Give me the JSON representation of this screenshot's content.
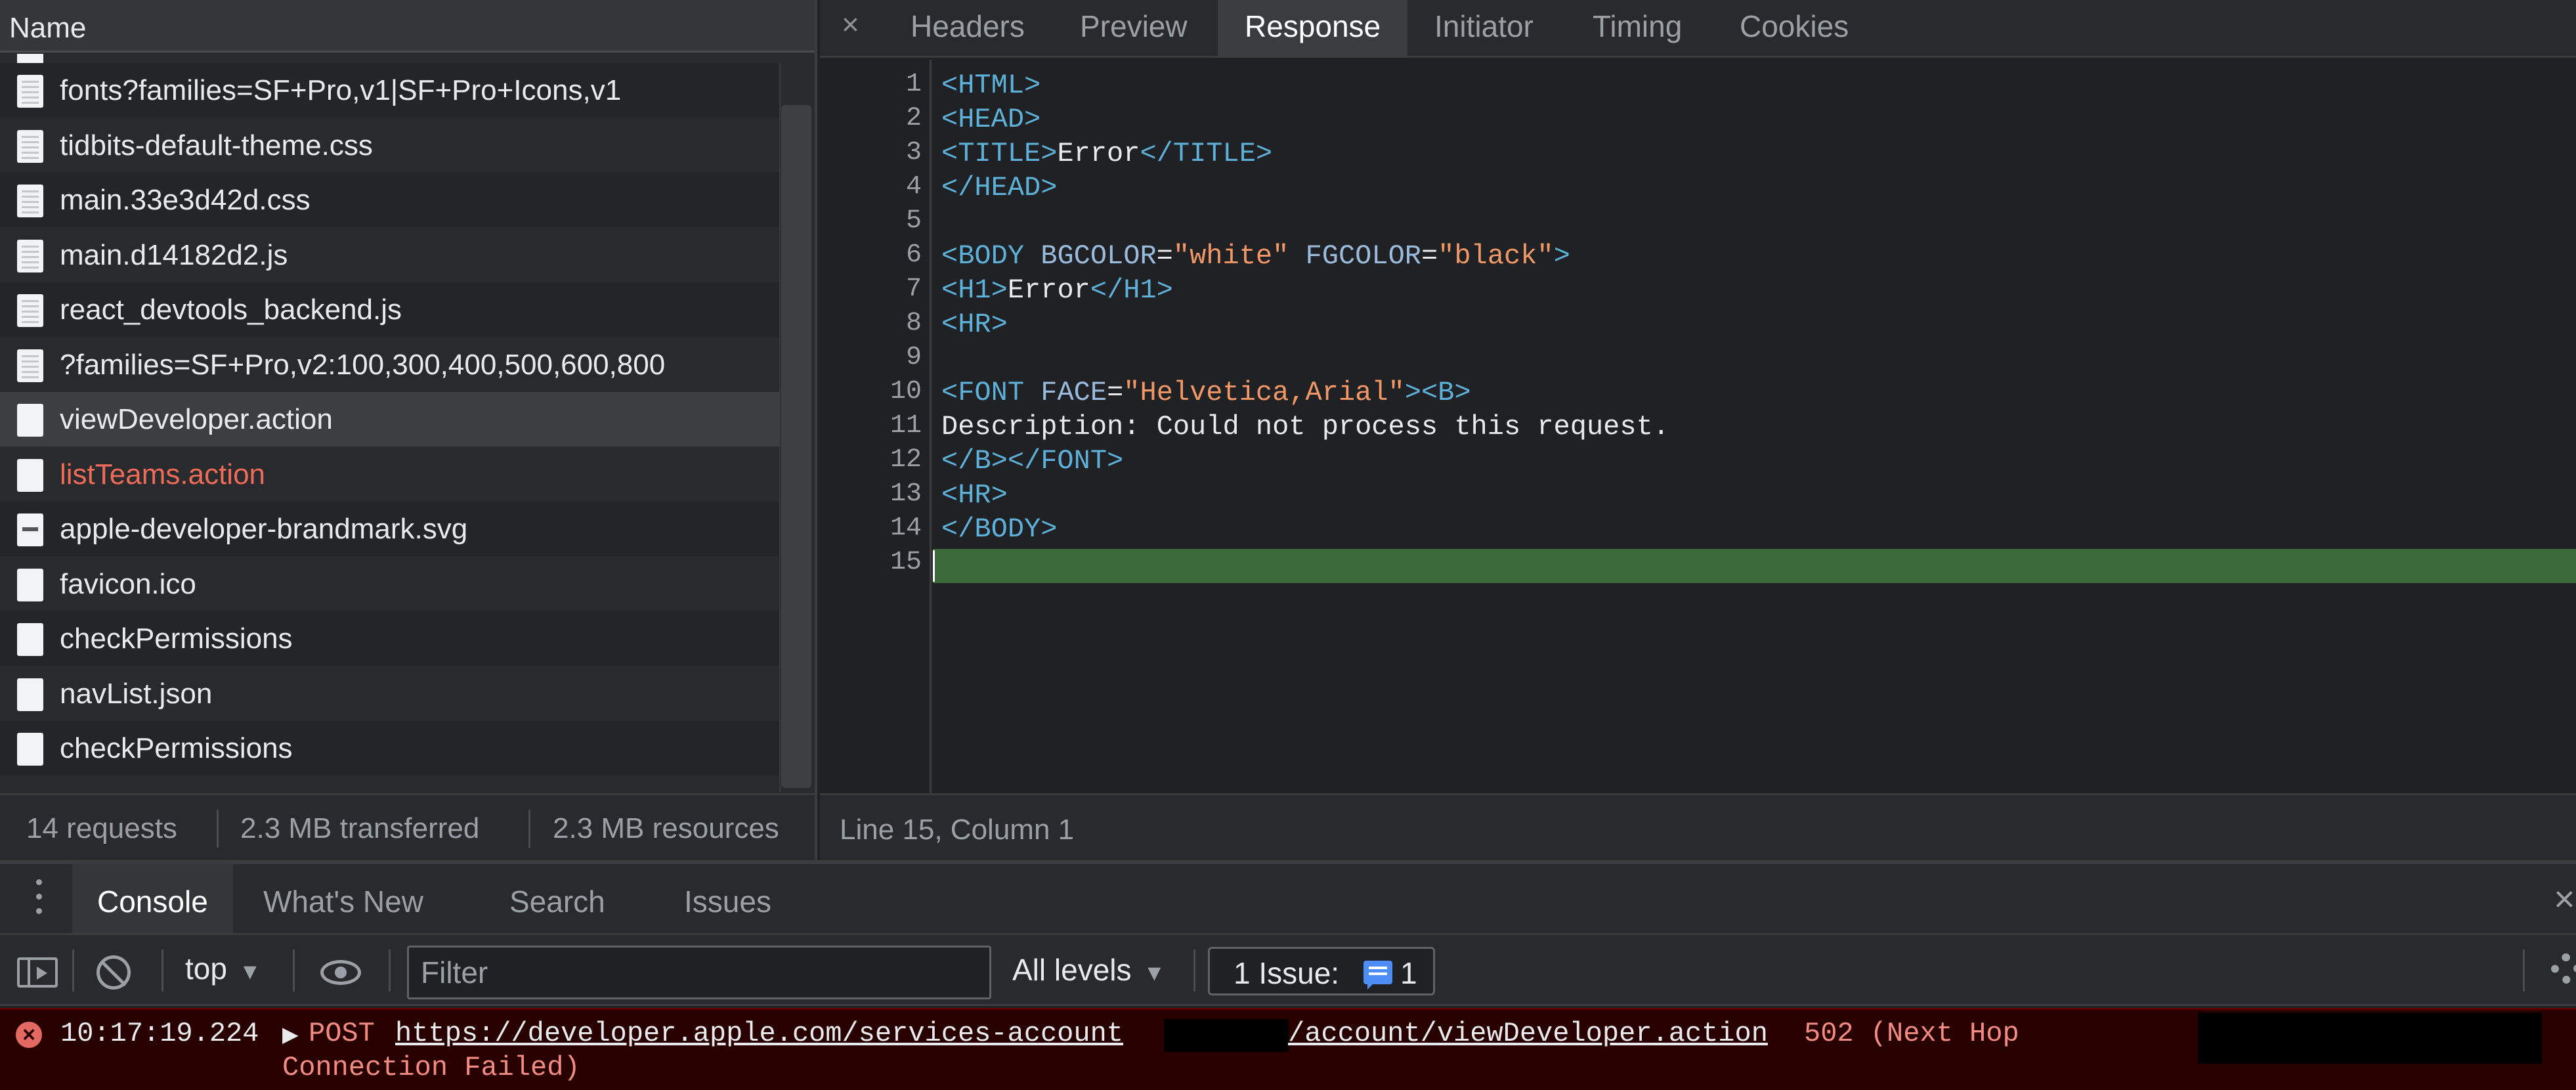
{
  "network": {
    "name_header": "Name",
    "requests": [
      {
        "name": "fonts?families=SF+Pro,v1|SF+Pro+Icons,v1",
        "icon": "document-icon",
        "status": "normal"
      },
      {
        "name": "tidbits-default-theme.css",
        "icon": "document-icon",
        "status": "normal"
      },
      {
        "name": "main.33e3d42d.css",
        "icon": "document-icon",
        "status": "normal"
      },
      {
        "name": "main.d14182d2.js",
        "icon": "document-icon",
        "status": "normal"
      },
      {
        "name": "react_devtools_backend.js",
        "icon": "document-icon",
        "status": "normal"
      },
      {
        "name": "?families=SF+Pro,v2:100,300,400,500,600,800",
        "icon": "document-icon",
        "status": "normal"
      },
      {
        "name": "viewDeveloper.action",
        "icon": "file-icon",
        "status": "selected"
      },
      {
        "name": "listTeams.action",
        "icon": "file-icon",
        "status": "error"
      },
      {
        "name": "apple-developer-brandmark.svg",
        "icon": "image-icon",
        "status": "normal"
      },
      {
        "name": "favicon.ico",
        "icon": "file-icon",
        "status": "normal"
      },
      {
        "name": "checkPermissions",
        "icon": "file-icon",
        "status": "normal"
      },
      {
        "name": "navList.json",
        "icon": "file-icon",
        "status": "normal"
      },
      {
        "name": "checkPermissions",
        "icon": "file-icon",
        "status": "normal"
      }
    ],
    "summary": {
      "requests": "14 requests",
      "transferred": "2.3 MB transferred",
      "resources": "2.3 MB resources"
    }
  },
  "details": {
    "close": "×",
    "tabs": [
      "Headers",
      "Preview",
      "Response",
      "Initiator",
      "Timing",
      "Cookies"
    ],
    "active_tab": "Response",
    "code_lines": [
      [
        {
          "t": "<HTML>",
          "c": "tag"
        }
      ],
      [
        {
          "t": "<HEAD>",
          "c": "tag"
        }
      ],
      [
        {
          "t": "<TITLE>",
          "c": "tag"
        },
        {
          "t": "Error",
          "c": "txt"
        },
        {
          "t": "</TITLE>",
          "c": "tag"
        }
      ],
      [
        {
          "t": "</HEAD>",
          "c": "tag"
        }
      ],
      [],
      [
        {
          "t": "<BODY ",
          "c": "tag"
        },
        {
          "t": "BGCOLOR",
          "c": "attr"
        },
        {
          "t": "=",
          "c": "txt"
        },
        {
          "t": "\"white\"",
          "c": "str"
        },
        {
          "t": " ",
          "c": "txt"
        },
        {
          "t": "FGCOLOR",
          "c": "attr"
        },
        {
          "t": "=",
          "c": "txt"
        },
        {
          "t": "\"black\"",
          "c": "str"
        },
        {
          "t": ">",
          "c": "tag"
        }
      ],
      [
        {
          "t": "<H1>",
          "c": "tag"
        },
        {
          "t": "Error",
          "c": "txt"
        },
        {
          "t": "</H1>",
          "c": "tag"
        }
      ],
      [
        {
          "t": "<HR>",
          "c": "tag"
        }
      ],
      [],
      [
        {
          "t": "<FONT ",
          "c": "tag"
        },
        {
          "t": "FACE",
          "c": "attr"
        },
        {
          "t": "=",
          "c": "txt"
        },
        {
          "t": "\"Helvetica,Arial\"",
          "c": "str"
        },
        {
          "t": "><B>",
          "c": "tag"
        }
      ],
      [
        {
          "t": "Description: Could not process this request.",
          "c": "txt"
        }
      ],
      [
        {
          "t": "</B></FONT>",
          "c": "tag"
        }
      ],
      [
        {
          "t": "<HR>",
          "c": "tag"
        }
      ],
      [
        {
          "t": "</BODY>",
          "c": "tag"
        }
      ],
      []
    ],
    "cursor_status": "Line 15, Column 1"
  },
  "drawer": {
    "tabs": [
      "Console",
      "What's New",
      "Search",
      "Issues"
    ],
    "active_tab": "Console",
    "close": "×"
  },
  "console_toolbar": {
    "context": "top",
    "filter_placeholder": "Filter",
    "levels": "All levels",
    "issues_label": "1 Issue:",
    "issues_count": "1"
  },
  "console_message": {
    "level": "error",
    "icon": "×",
    "timestamp": "10:17:19.224",
    "method": "POST",
    "url_part1": "https://developer.apple.com/services-account",
    "url_part2": "/account/viewDeveloper.action",
    "status": "502 (Next Hop",
    "status_cont": "Connection Failed)"
  },
  "colors": {
    "background": "#202124",
    "panel": "#292a2d",
    "tag": "#5db0d7",
    "attribute": "#9bbbdc",
    "string": "#f29766",
    "error_text": "#f28b82",
    "error_bg": "#290000",
    "selected_line": "#3d6a39",
    "issue_blue": "#4d8df6"
  }
}
